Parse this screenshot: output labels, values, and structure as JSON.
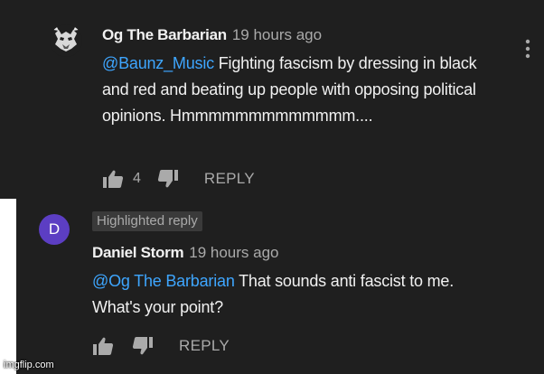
{
  "comments": [
    {
      "author": "Og The Barbarian",
      "time": "19 hours ago",
      "mention": "@Baunz_Music",
      "text": " Fighting fascism by dressing in black and red and beating up people with opposing political opinions. Hmmmmmmmmmmmmm....",
      "likes": "4",
      "reply_label": "REPLY",
      "avatar_icon": "barbarian-avatar-icon"
    },
    {
      "badge": "Highlighted reply",
      "avatar_letter": "D",
      "author": "Daniel Storm",
      "time": "19 hours ago",
      "mention": "@Og The Barbarian",
      "text": " That sounds anti fascist to me. What's your point?",
      "reply_label": "REPLY",
      "avatar_color": "#5c3ec3"
    }
  ],
  "watermark": "imgflip.com",
  "colors": {
    "background": "#1f1f1f",
    "mention": "#3ea6ff",
    "text": "#f1f1f1",
    "muted": "#aaaaaa"
  }
}
